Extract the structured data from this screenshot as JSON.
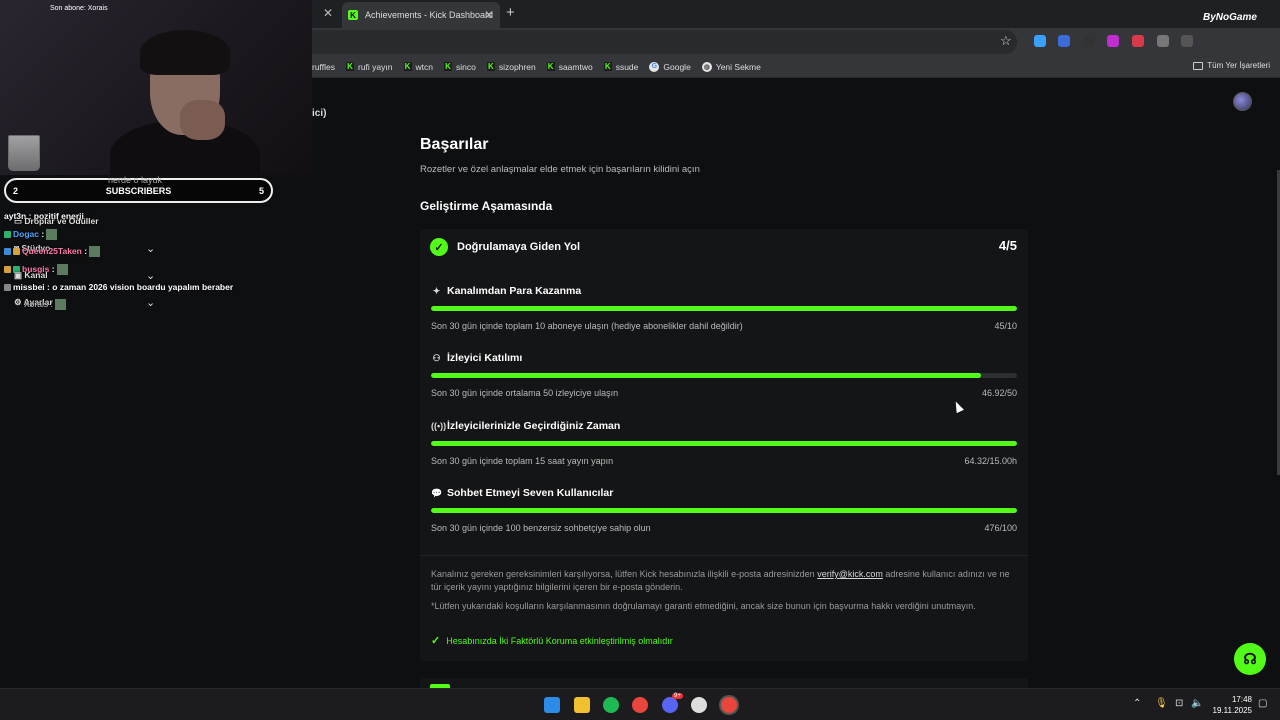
{
  "browser": {
    "active_tab_title": "Achievements - Kick Dashboard",
    "bookmarks": [
      "ruffles",
      "rufi yayın",
      "wtcn",
      "sinco",
      "sizophren",
      "saamtwo",
      "ssude",
      "Google",
      "Yeni Sekme"
    ],
    "all_bookmarks": "Tüm Yer İşaretleri"
  },
  "overlay": {
    "last_sub": "Son abone: Xorais",
    "subs_left": "2",
    "subs_label": "SUBSCRIBERS",
    "subs_right": "5",
    "logo": "ByNoGame",
    "sidebar_fragment": "ici)",
    "chat": [
      {
        "user": "",
        "text": "nerde o layuk"
      },
      {
        "user": "ayt3n",
        "text": ": pozitif enerji"
      },
      {
        "user": "Dogac",
        "text": ":"
      },
      {
        "user": "Queen25Taken",
        "text": ":"
      },
      {
        "user": "busgis",
        "text": ":"
      },
      {
        "user": "missbei",
        "text": ": o zaman 2026 vision boardu yapalım beraber"
      },
      {
        "user": "Xorais",
        "text": ":"
      }
    ],
    "menu": [
      "Droplar ve Ödüller",
      "Stüdyo",
      "Kanal",
      "Ayarlar"
    ]
  },
  "page": {
    "title": "Başarılar",
    "subtitle": "Rozetler ve özel anlaşmalar elde etmek için başarıların kilidini açın",
    "section": "Geliştirme Aşamasında",
    "card": {
      "title": "Doğrulamaya Giden Yol",
      "count": "4/5",
      "items": [
        {
          "icon": "sparkle-icon",
          "title": "Kanalımdan Para Kazanma",
          "desc": "Son 30 gün içinde toplam 10 aboneye ulaşın (hediye abonelikler dahil değildir)",
          "value": "45/10",
          "progress": 1.0
        },
        {
          "icon": "people-icon",
          "title": "İzleyici Katılımı",
          "desc": "Son 30 gün içinde ortalama 50 izleyiciye ulaşın",
          "value": "46.92/50",
          "progress": 0.9384
        },
        {
          "icon": "broadcast-icon",
          "title": "İzleyicilerinizle Geçirdiğiniz Zaman",
          "desc": "Son 30 gün içinde toplam 15 saat yayın yapın",
          "value": "64.32/15.00h",
          "progress": 1.0
        },
        {
          "icon": "chat-bubble-icon",
          "title": "Sohbet Etmeyi Seven Kullanıcılar",
          "desc": "Son 30 gün içinde 100 benzersiz sohbetçiye sahip olun",
          "value": "476/100",
          "progress": 1.0
        }
      ],
      "note1_a": "Kanalınız gereken gereksinimleri karşılıyorsa, lütfen Kick hesabınızla ilişkili e-posta adresinizden",
      "note1_link": "verify@kick.com",
      "note1_b": "adresine kullanıcı adınızı ve ne tür içerik yayını yaptığınız bilgilerini içeren bir e-posta gönderin.",
      "note2": "*Lütfen yukarıdaki koşulların karşılanmasının doğrulamayı garanti etmediğini, ancak size bunun için başvurma hakkı verdiğini unutmayın.",
      "twofa": "Hesabınızda İki Faktörlü Koruma etkinleştirilmiş olmalıdır"
    }
  },
  "taskbar": {
    "time": "17:48",
    "date": "19.11.2025",
    "discord_badge": "9+"
  },
  "colors": {
    "accent": "#53fc18",
    "background": "#0e0f11",
    "card": "#141517"
  }
}
